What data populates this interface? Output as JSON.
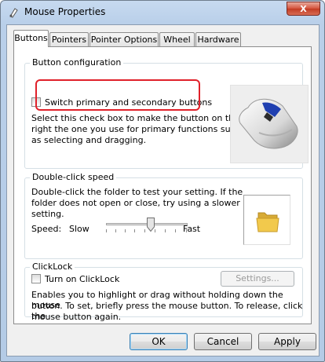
{
  "window": {
    "title": "Mouse Properties",
    "close_glyph": "X"
  },
  "tabs": [
    "Buttons",
    "Pointers",
    "Pointer Options",
    "Wheel",
    "Hardware"
  ],
  "active_tab": "Buttons",
  "button_configuration": {
    "legend": "Button configuration",
    "checkbox_label": "Switch primary and secondary buttons",
    "checked": false,
    "description_lines": [
      "Select this check box to make the button on the",
      "right the one you use for primary functions such",
      "as selecting and dragging."
    ]
  },
  "double_click": {
    "legend": "Double-click speed",
    "description_lines": [
      "Double-click the folder to test your setting. If the",
      "folder does not open or close, try using a slower",
      "setting."
    ],
    "speed_label": "Speed:",
    "slow_label": "Slow",
    "fast_label": "Fast",
    "speed_level": 0.55
  },
  "clicklock": {
    "legend": "ClickLock",
    "checkbox_label": "Turn on ClickLock",
    "checked": false,
    "settings_label": "Settings...",
    "description_lines": [
      "Enables you to highlight or drag without holding down the mouse",
      "button. To set, briefly press the mouse button. To release, click the",
      "mouse button again."
    ]
  },
  "buttons": {
    "ok": "OK",
    "cancel": "Cancel",
    "apply": "Apply"
  },
  "colors": {
    "highlight_annotation": "#e0212a",
    "folder": "#f2c94c"
  }
}
